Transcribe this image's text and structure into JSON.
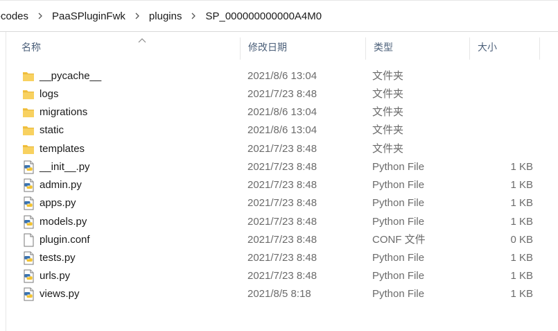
{
  "breadcrumb": {
    "items": [
      "-codes",
      "PaaSPluginFwk",
      "plugins",
      "SP_000000000000A4M0"
    ]
  },
  "columns": {
    "name": "名称",
    "modified": "修改日期",
    "type": "类型",
    "size": "大小"
  },
  "colors": {
    "header_text": "#4c607a",
    "folder": "#f5c342",
    "secondary_text": "#6b6b6b"
  },
  "files": [
    {
      "name": "__pycache__",
      "modified": "2021/8/6 13:04",
      "type": "文件夹",
      "size": "",
      "icon": "folder-icon"
    },
    {
      "name": "logs",
      "modified": "2021/7/23 8:48",
      "type": "文件夹",
      "size": "",
      "icon": "folder-icon"
    },
    {
      "name": "migrations",
      "modified": "2021/8/6 13:04",
      "type": "文件夹",
      "size": "",
      "icon": "folder-icon"
    },
    {
      "name": "static",
      "modified": "2021/8/6 13:04",
      "type": "文件夹",
      "size": "",
      "icon": "folder-icon"
    },
    {
      "name": "templates",
      "modified": "2021/7/23 8:48",
      "type": "文件夹",
      "size": "",
      "icon": "folder-icon"
    },
    {
      "name": "__init__.py",
      "modified": "2021/7/23 8:48",
      "type": "Python File",
      "size": "1 KB",
      "icon": "python-file-icon"
    },
    {
      "name": "admin.py",
      "modified": "2021/7/23 8:48",
      "type": "Python File",
      "size": "1 KB",
      "icon": "python-file-icon"
    },
    {
      "name": "apps.py",
      "modified": "2021/7/23 8:48",
      "type": "Python File",
      "size": "1 KB",
      "icon": "python-file-icon"
    },
    {
      "name": "models.py",
      "modified": "2021/7/23 8:48",
      "type": "Python File",
      "size": "1 KB",
      "icon": "python-file-icon"
    },
    {
      "name": "plugin.conf",
      "modified": "2021/7/23 8:48",
      "type": "CONF 文件",
      "size": "0 KB",
      "icon": "document-icon"
    },
    {
      "name": "tests.py",
      "modified": "2021/7/23 8:48",
      "type": "Python File",
      "size": "1 KB",
      "icon": "python-file-icon"
    },
    {
      "name": "urls.py",
      "modified": "2021/7/23 8:48",
      "type": "Python File",
      "size": "1 KB",
      "icon": "python-file-icon"
    },
    {
      "name": "views.py",
      "modified": "2021/8/5 8:18",
      "type": "Python File",
      "size": "1 KB",
      "icon": "python-file-icon"
    }
  ]
}
